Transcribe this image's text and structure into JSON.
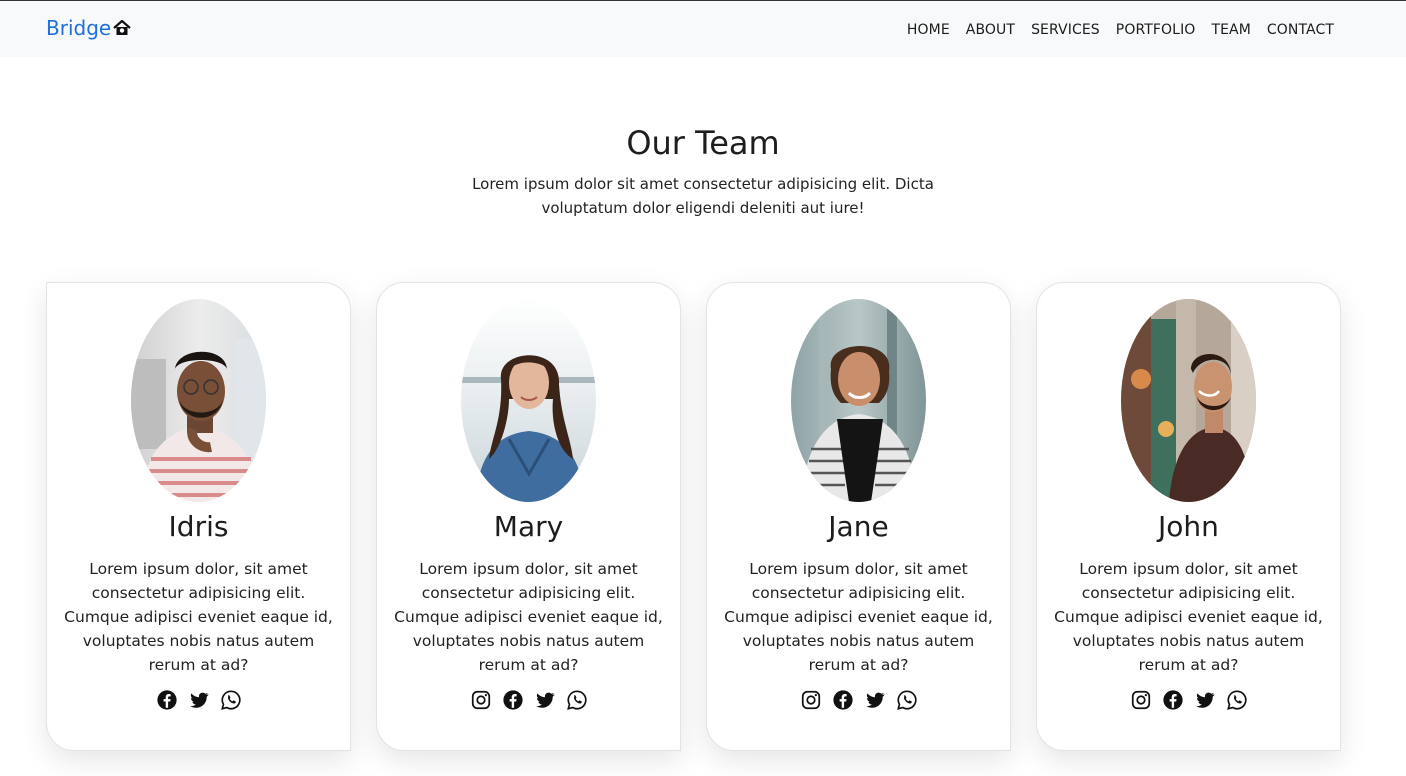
{
  "navbar": {
    "brand": "Bridge",
    "brand_icon": "house-icon",
    "links": [
      "HOME",
      "ABOUT",
      "SERVICES",
      "PORTFOLIO",
      "TEAM",
      "CONTACT"
    ]
  },
  "section": {
    "title": "Our Team",
    "subtitle": "Lorem ipsum dolor sit amet consectetur adipisicing elit. Dicta voluptatum dolor eligendi deleniti aut iure!"
  },
  "team": [
    {
      "name": "Idris",
      "description": "Lorem ipsum dolor, sit amet consectetur adipisicing elit. Cumque adipisci eveniet eaque id, voluptates nobis natus autem rerum at ad?",
      "socials": [
        "facebook-icon",
        "twitter-icon",
        "whatsapp-icon"
      ]
    },
    {
      "name": "Mary",
      "description": "Lorem ipsum dolor, sit amet consectetur adipisicing elit. Cumque adipisci eveniet eaque id, voluptates nobis natus autem rerum at ad?",
      "socials": [
        "instagram-icon",
        "facebook-icon",
        "twitter-icon",
        "whatsapp-icon"
      ]
    },
    {
      "name": "Jane",
      "description": "Lorem ipsum dolor, sit amet consectetur adipisicing elit. Cumque adipisci eveniet eaque id, voluptates nobis natus autem rerum at ad?",
      "socials": [
        "instagram-icon",
        "facebook-icon",
        "twitter-icon",
        "whatsapp-icon"
      ]
    },
    {
      "name": "John",
      "description": "Lorem ipsum dolor, sit amet consectetur adipisicing elit. Cumque adipisci eveniet eaque id, voluptates nobis natus autem rerum at ad?",
      "socials": [
        "instagram-icon",
        "facebook-icon",
        "twitter-icon",
        "whatsapp-icon"
      ]
    }
  ],
  "colors": {
    "brand": "#1e6fd9",
    "navbar_bg": "#f8f9fa",
    "text": "#212529"
  }
}
